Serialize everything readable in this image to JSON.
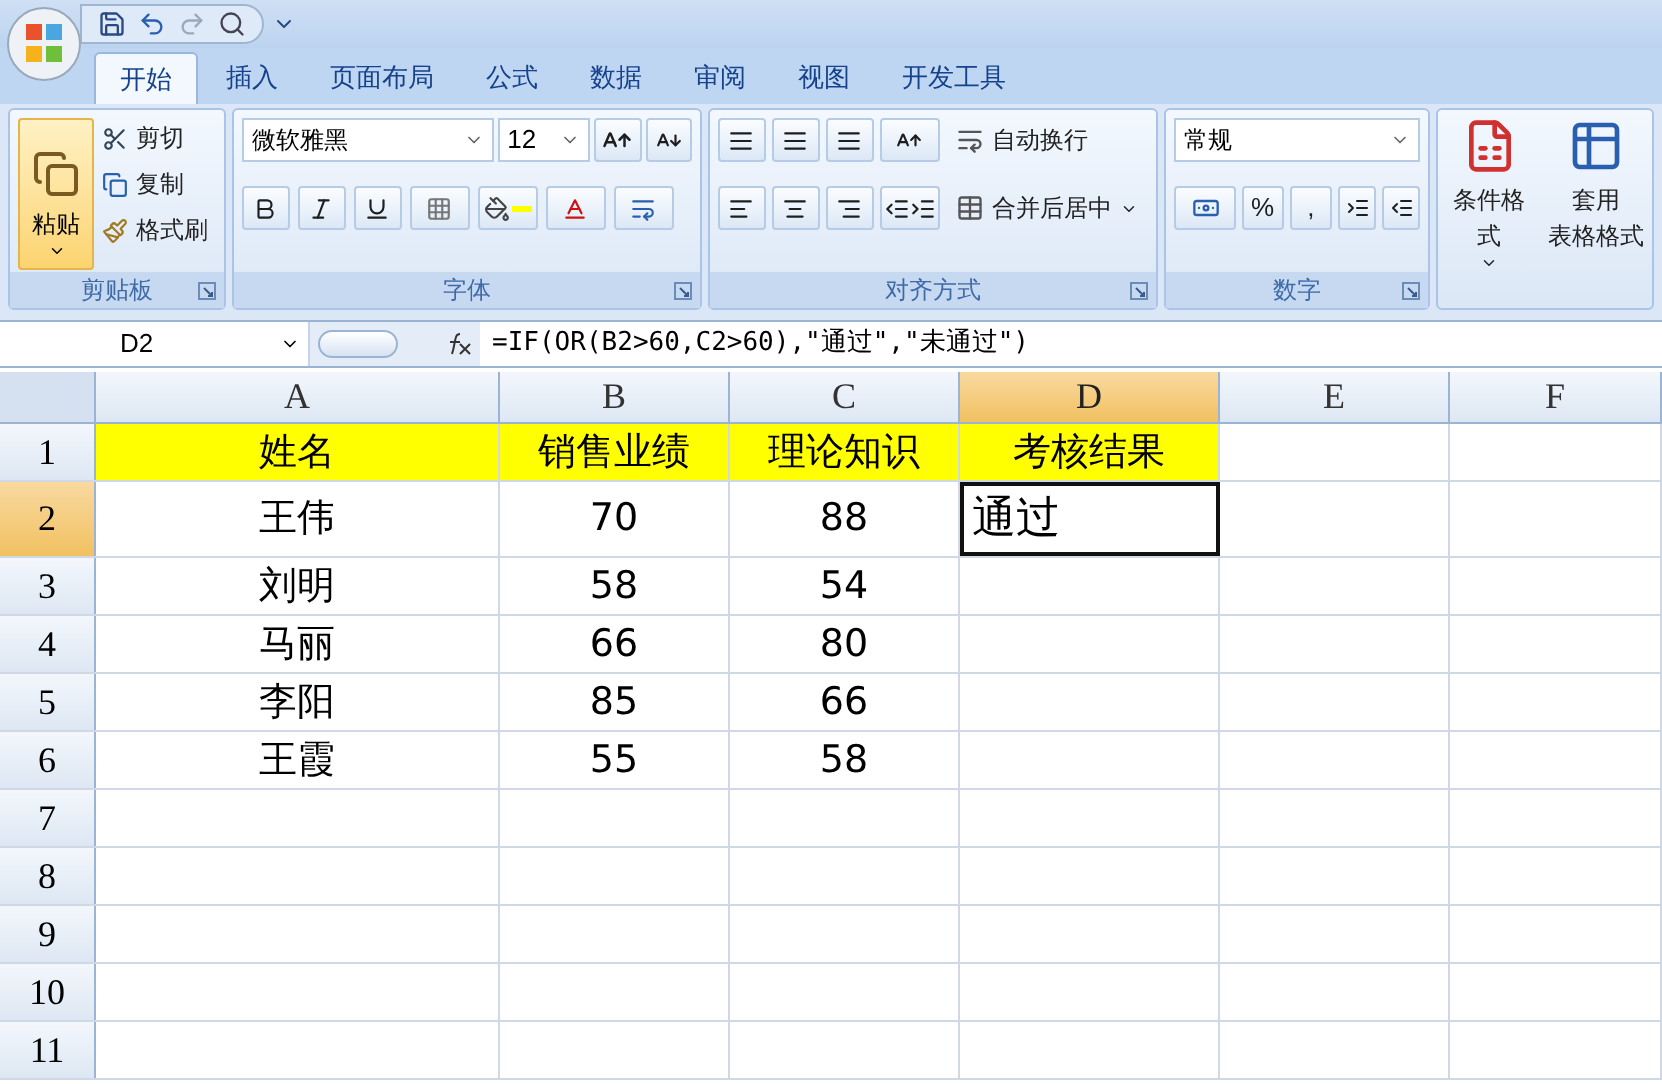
{
  "tabs": [
    {
      "label": "开始",
      "selected": true
    },
    {
      "label": "插入",
      "selected": false
    },
    {
      "label": "页面布局",
      "selected": false
    },
    {
      "label": "公式",
      "selected": false
    },
    {
      "label": "数据",
      "selected": false
    },
    {
      "label": "审阅",
      "selected": false
    },
    {
      "label": "视图",
      "selected": false
    },
    {
      "label": "开发工具",
      "selected": false
    }
  ],
  "clipboard": {
    "paste": "粘贴",
    "cut": "剪切",
    "copy": "复制",
    "format_painter": "格式刷",
    "label": "剪贴板"
  },
  "font": {
    "name": "微软雅黑",
    "size": "12",
    "label": "字体"
  },
  "alignment": {
    "wrap_text": "自动换行",
    "merge_center": "合并后居中",
    "label": "对齐方式"
  },
  "number": {
    "format": "常规",
    "symbols": [
      "%",
      ","
    ],
    "label": "数字"
  },
  "styles": {
    "conditional_format": "条件格式",
    "table_format_line1": "套用",
    "table_format_line2": "表格格式"
  },
  "formula_bar": {
    "name_box": "D2",
    "formula": "=IF(OR(B2>60,C2>60),\"通过\",\"未通过\")"
  },
  "sheet": {
    "columns": [
      {
        "label": "A",
        "selected": false
      },
      {
        "label": "B",
        "selected": false
      },
      {
        "label": "C",
        "selected": false
      },
      {
        "label": "D",
        "selected": true
      },
      {
        "label": "E",
        "selected": false
      },
      {
        "label": "F",
        "selected": false
      }
    ],
    "rows": [
      {
        "label": "1",
        "selected": false,
        "color": "#ffff00",
        "cells": [
          {
            "text": "姓名",
            "active": false
          },
          {
            "text": "销售业绩",
            "active": false
          },
          {
            "text": "理论知识",
            "active": false
          },
          {
            "text": "考核结果",
            "active": false
          }
        ]
      },
      {
        "label": "2",
        "selected": true,
        "cells": [
          {
            "text": "王伟",
            "active": false
          },
          {
            "text": "70",
            "active": false
          },
          {
            "text": "88",
            "active": false
          },
          {
            "text": "通过",
            "active": true
          }
        ]
      },
      {
        "label": "3",
        "selected": false,
        "cells": [
          {
            "text": "刘明",
            "active": false
          },
          {
            "text": "58",
            "active": false
          },
          {
            "text": "54",
            "active": false
          }
        ]
      },
      {
        "label": "4",
        "selected": false,
        "cells": [
          {
            "text": "马丽",
            "active": false
          },
          {
            "text": "66",
            "active": false
          },
          {
            "text": "80",
            "active": false
          }
        ]
      },
      {
        "label": "5",
        "selected": false,
        "cells": [
          {
            "text": "李阳",
            "active": false
          },
          {
            "text": "85",
            "active": false
          },
          {
            "text": "66",
            "active": false
          }
        ]
      },
      {
        "label": "6",
        "selected": false,
        "cells": [
          {
            "text": "王霞",
            "active": false
          },
          {
            "text": "55",
            "active": false
          },
          {
            "text": "58",
            "active": false
          }
        ]
      },
      {
        "label": "7",
        "selected": false
      },
      {
        "label": "8",
        "selected": false
      },
      {
        "label": "9",
        "selected": false
      },
      {
        "label": "10",
        "selected": false
      },
      {
        "label": "11",
        "selected": false
      }
    ]
  }
}
